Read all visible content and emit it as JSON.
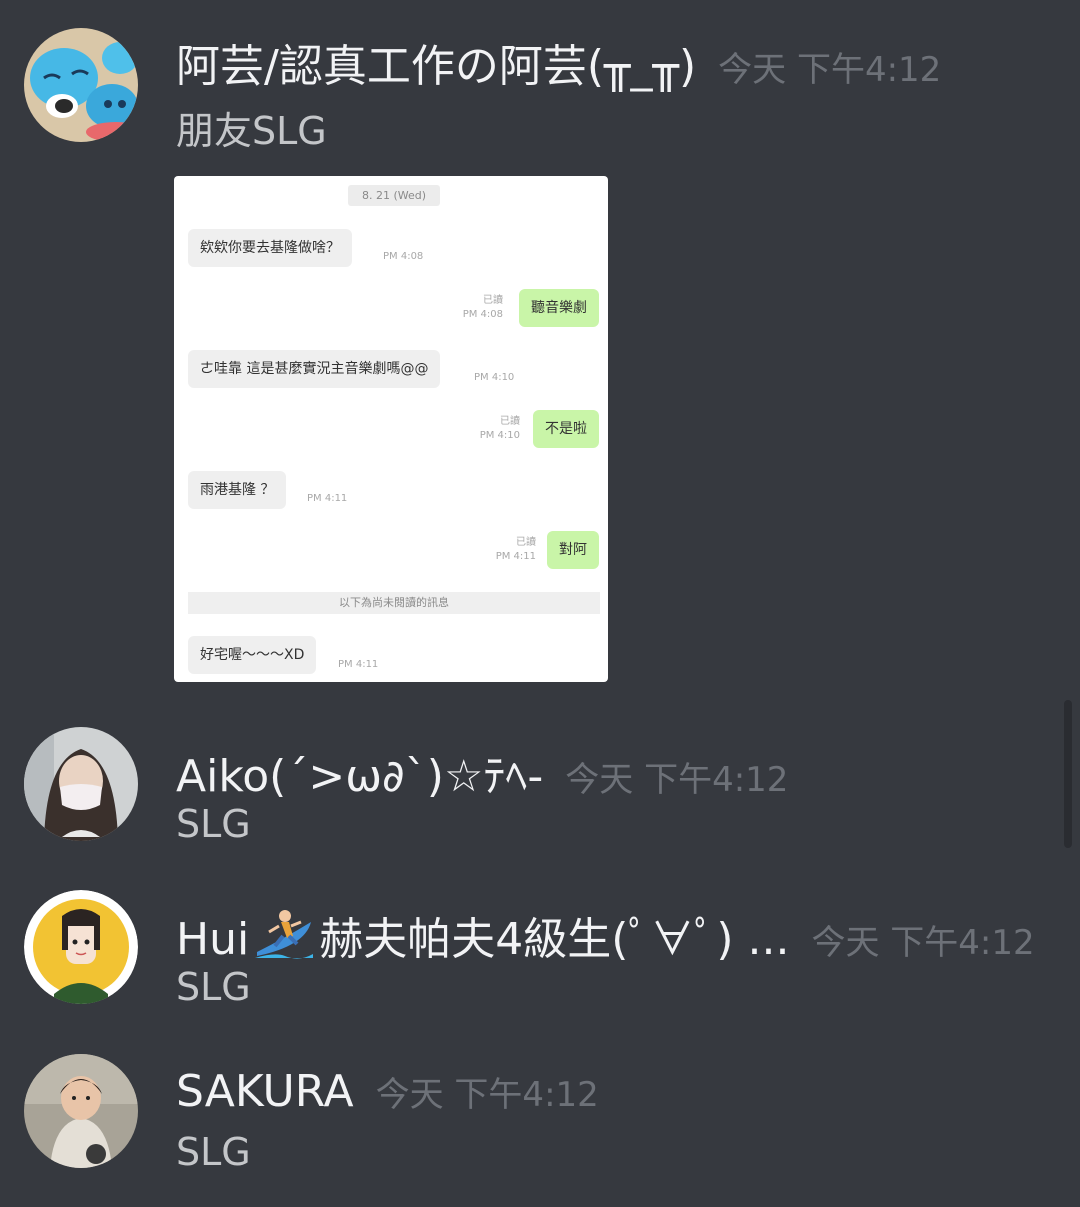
{
  "messages": [
    {
      "username": "阿芸/認真工作の阿芸(╥_╥)",
      "timestamp": "今天 下午4:12",
      "text": "朋友SLG"
    },
    {
      "username": "Aiko⁠(´>ω∂`)☆ﾃﾍ-",
      "timestamp": "今天 下午4:12",
      "text": "SLG"
    },
    {
      "username_before_emoji": "Hui",
      "emoji": "surfer-emoji",
      "username_after_emoji": "赫夫帕夫4級生(ﾟ∀ﾟ) ...",
      "timestamp": "今天 下午4:12",
      "text": "SLG"
    },
    {
      "username": "SAKURA",
      "timestamp": "今天 下午4:12",
      "text": "SLG"
    }
  ],
  "attachment": {
    "date": "8. 21 (Wed)",
    "read_label": "已讀",
    "unread_divider": "以下為尚未閱讀的訊息",
    "chat": [
      {
        "dir": "in",
        "text": "欸欸你要去基隆做啥？",
        "time": "PM 4:08"
      },
      {
        "dir": "out",
        "text": "聽音樂劇",
        "time": "PM 4:08"
      },
      {
        "dir": "in",
        "text": "ㄜ哇靠 這是甚麼實況主音樂劇嗎@@",
        "time": "PM 4:10"
      },
      {
        "dir": "out",
        "text": "不是啦",
        "time": "PM 4:10"
      },
      {
        "dir": "in",
        "text": "雨港基隆 ？",
        "time": "PM 4:11"
      },
      {
        "dir": "out",
        "text": "對阿",
        "time": "PM 4:11"
      },
      {
        "dir": "in",
        "text": "好宅喔～～～XD",
        "time": "PM 4:11"
      }
    ]
  },
  "colors": {
    "background": "#36393f",
    "username": "#f2f3f5",
    "timestamp": "#6d7178",
    "message_text": "#c4c6c9",
    "bubble_out": "#c9f5a8",
    "bubble_in": "#efefef"
  }
}
